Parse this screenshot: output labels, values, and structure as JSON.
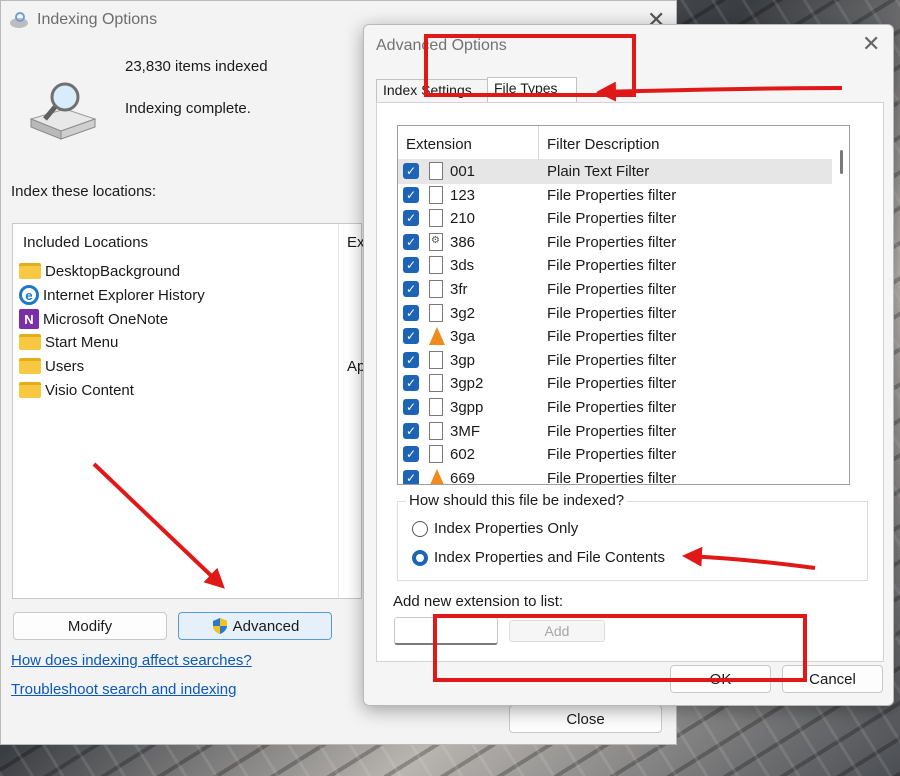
{
  "main": {
    "title": "Indexing Options",
    "items_indexed": "23,830 items indexed",
    "status": "Indexing complete.",
    "index_locations_label": "Index these locations:",
    "included_header": "Included Locations",
    "excluded_header": "Ex",
    "excluded_value": "Ap",
    "locations": [
      {
        "label": "DesktopBackground",
        "icon": "folder-icon"
      },
      {
        "label": "Internet Explorer History",
        "icon": "internet-explorer-icon"
      },
      {
        "label": "Microsoft OneNote",
        "icon": "onenote-icon"
      },
      {
        "label": "Start Menu",
        "icon": "folder-icon"
      },
      {
        "label": "Users",
        "icon": "folder-icon"
      },
      {
        "label": "Visio Content",
        "icon": "folder-icon"
      }
    ],
    "modify_label": "Modify",
    "advanced_label": "Advanced",
    "link_affect": "How does indexing affect searches?",
    "link_troubleshoot": "Troubleshoot search and indexing",
    "close_label": "Close"
  },
  "advanced": {
    "title": "Advanced Options",
    "tab_index": "Index Settings",
    "tab_types": "File Types",
    "col_extension": "Extension",
    "col_filter": "Filter Description",
    "rows": [
      {
        "ext": "001",
        "desc": "Plain Text Filter",
        "icon": "file-icon"
      },
      {
        "ext": "123",
        "desc": "File Properties filter",
        "icon": "file-icon"
      },
      {
        "ext": "210",
        "desc": "File Properties filter",
        "icon": "file-icon"
      },
      {
        "ext": "386",
        "desc": "File Properties filter",
        "icon": "file-settings-icon"
      },
      {
        "ext": "3ds",
        "desc": "File Properties filter",
        "icon": "file-icon"
      },
      {
        "ext": "3fr",
        "desc": "File Properties filter",
        "icon": "file-icon"
      },
      {
        "ext": "3g2",
        "desc": "File Properties filter",
        "icon": "file-icon"
      },
      {
        "ext": "3ga",
        "desc": "File Properties filter",
        "icon": "vlc-cone-icon"
      },
      {
        "ext": "3gp",
        "desc": "File Properties filter",
        "icon": "file-icon"
      },
      {
        "ext": "3gp2",
        "desc": "File Properties filter",
        "icon": "file-icon"
      },
      {
        "ext": "3gpp",
        "desc": "File Properties filter",
        "icon": "file-icon"
      },
      {
        "ext": "3MF",
        "desc": "File Properties filter",
        "icon": "file-icon"
      },
      {
        "ext": "602",
        "desc": "File Properties filter",
        "icon": "file-icon"
      },
      {
        "ext": "669",
        "desc": "File Properties filter",
        "icon": "vlc-cone-icon"
      }
    ],
    "how_label": "How should this file be indexed?",
    "option_properties": "Index Properties Only",
    "option_contents": "Index Properties and File Contents",
    "selected_option": "option_contents",
    "add_label": "Add new extension to list:",
    "add_input_value": "",
    "add_button": "Add",
    "ok_label": "OK",
    "cancel_label": "Cancel"
  },
  "colors": {
    "accent": "#1d63b6",
    "link": "#0a59bd",
    "annotation_red": "#e01818"
  }
}
